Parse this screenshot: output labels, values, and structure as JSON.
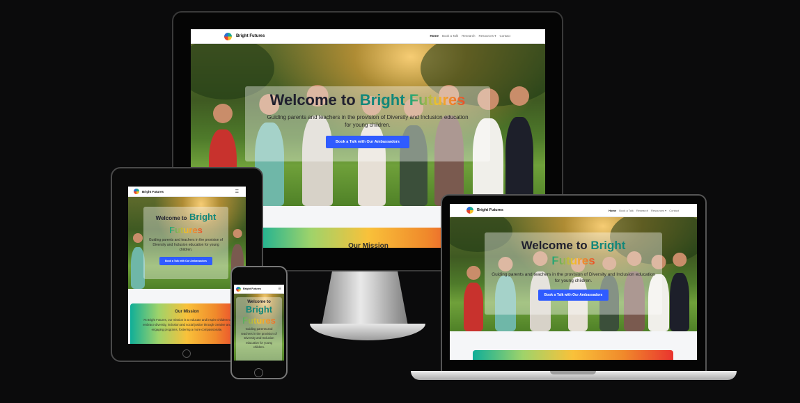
{
  "site": {
    "brand": "Bright Futures",
    "nav": [
      "Home",
      "Book a Talk",
      "Research",
      "Resources ▾",
      "Contact"
    ],
    "hero_welcome": "Welcome to",
    "hero_bright": "Bright",
    "hero_futures": "Futures",
    "hero_subtitle": "Guiding parents and teachers in the provision of Diversity and Inclusion education for young children.",
    "cta": "Book a Talk with Our Ambassadors",
    "mission_title": "Our Mission",
    "mission_text": "\"At Bright Futures, our mission is to educate and inspire children to embrace diversity, inclusion and social justice through creative and engaging programs, fostering a more compassionate,",
    "menu_icon": "☰"
  },
  "colors": {
    "background": "#0b0b0c",
    "accent": "#2f5bff",
    "bright_text": "#12877a"
  }
}
